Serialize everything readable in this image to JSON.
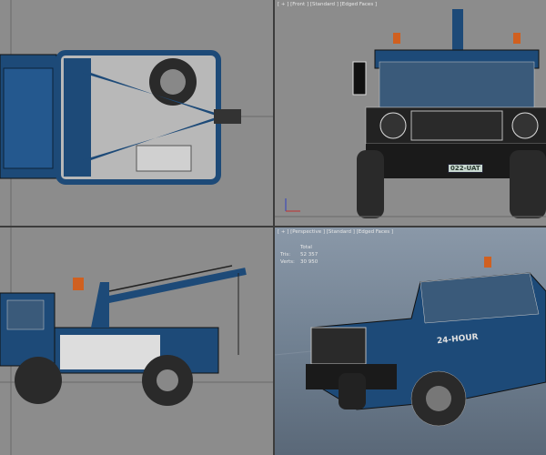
{
  "viewports": {
    "top": {
      "label": ""
    },
    "front": {
      "label": "[ + ] [Front ] [Standard ] [Edged Faces ]",
      "plate": "022-UAT"
    },
    "left": {
      "label": ""
    },
    "perspective": {
      "label": "[ + ] [Perspective ] [Standard ] [Edged Faces ]",
      "stats": {
        "header": "Total",
        "tris_label": "Tris:",
        "tris": "52 357",
        "verts_label": "Verts:",
        "verts": "30 950"
      },
      "truck_text": "24-HOUR"
    }
  },
  "colors": {
    "bg": "#8c8c8c",
    "truck_blue": "#1f4f80",
    "dark": "#1a1a1a"
  }
}
